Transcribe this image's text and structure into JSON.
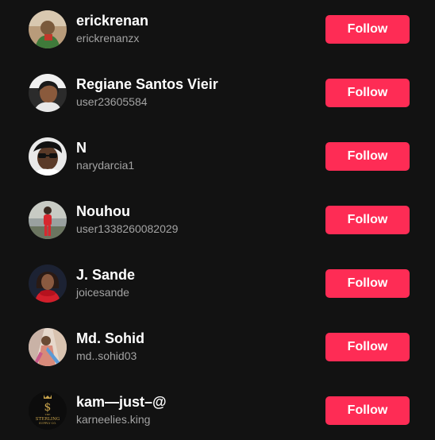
{
  "accent": "#fe2c55",
  "users": [
    {
      "name": "erickrenan",
      "handle": "erickrenanzx",
      "follow_label": "Follow"
    },
    {
      "name": "Regiane Santos Vieir",
      "handle": "user23605584",
      "follow_label": "Follow"
    },
    {
      "name": "N",
      "handle": "narydarcia1",
      "follow_label": "Follow"
    },
    {
      "name": "Nouhou",
      "handle": "user1338260082029",
      "follow_label": "Follow"
    },
    {
      "name": "J. Sande",
      "handle": "joicesande",
      "follow_label": "Follow"
    },
    {
      "name": "Md. Sohid",
      "handle": "md..sohid03",
      "follow_label": "Follow"
    },
    {
      "name": "kam—just–@",
      "handle": "karneelies.king",
      "follow_label": "Follow"
    }
  ],
  "logo_text": {
    "top": "THE",
    "middle": "STERLING",
    "bottom": "SUPPLY CO."
  }
}
